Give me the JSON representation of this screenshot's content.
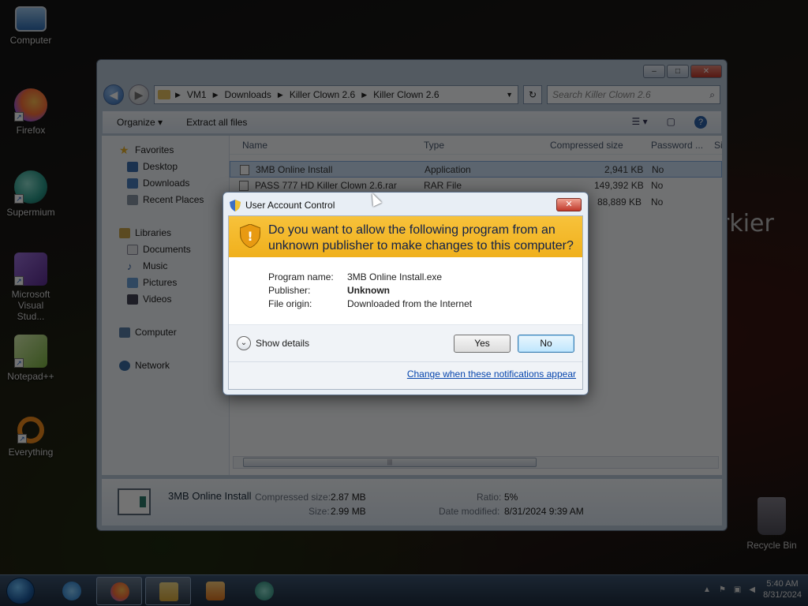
{
  "desktop": {
    "icons": [
      {
        "label": "Computer",
        "icon": "computer-icon"
      },
      {
        "label": "Firefox",
        "icon": "firefox-icon"
      },
      {
        "label": "Supermium",
        "icon": "supermium-icon"
      },
      {
        "label": "Microsoft Visual Stud...",
        "icon": "visual-studio-icon"
      },
      {
        "label": "Notepad++",
        "icon": "notepadpp-icon"
      },
      {
        "label": "Everything",
        "icon": "everything-icon"
      }
    ],
    "recycle_bin": "Recycle Bin",
    "background_text": "rkier"
  },
  "explorer": {
    "breadcrumb": [
      "VM1",
      "Downloads",
      "Killer Clown 2.6",
      "Killer Clown 2.6"
    ],
    "search_placeholder": "Search Killer Clown 2.6",
    "toolbar": {
      "organize": "Organize",
      "extract": "Extract all files"
    },
    "nav": {
      "favorites": "Favorites",
      "fav_items": [
        "Desktop",
        "Downloads",
        "Recent Places"
      ],
      "libraries": "Libraries",
      "lib_items": [
        "Documents",
        "Music",
        "Pictures",
        "Videos"
      ],
      "computer": "Computer",
      "network": "Network"
    },
    "columns": [
      "Name",
      "Type",
      "Compressed size",
      "Password ...",
      "Si"
    ],
    "rows": [
      {
        "name": "3MB Online Install",
        "type": "Application",
        "size": "2,941 KB",
        "password": "No"
      },
      {
        "name": "PASS 777 HD Killer Clown 2.6.rar",
        "type": "RAR File",
        "size": "149,392 KB",
        "password": "No"
      },
      {
        "name": "",
        "type": "",
        "size": "88,889 KB",
        "password": "No"
      }
    ],
    "details": {
      "name": "3MB Online Install",
      "compressed_label": "Compressed size:",
      "compressed_value": "2.87 MB",
      "size_label": "Size:",
      "size_value": "2.99 MB",
      "ratio_label": "Ratio:",
      "ratio_value": "5%",
      "modified_label": "Date modified:",
      "modified_value": "8/31/2024 9:39 AM"
    }
  },
  "uac": {
    "title": "User Account Control",
    "question_line1": "Do you want to allow the following program from an",
    "question_line2": "unknown publisher to make changes to this computer?",
    "program_label": "Program name:",
    "program_value": "3MB Online Install.exe",
    "publisher_label": "Publisher:",
    "publisher_value": "Unknown",
    "origin_label": "File origin:",
    "origin_value": "Downloaded from the Internet",
    "show_details": "Show details",
    "yes": "Yes",
    "no": "No",
    "change_link": "Change when these notifications appear",
    "banner_color": "#f4b82a"
  },
  "taskbar": {
    "clock_time": "5:40 AM",
    "clock_date": "8/31/2024"
  }
}
